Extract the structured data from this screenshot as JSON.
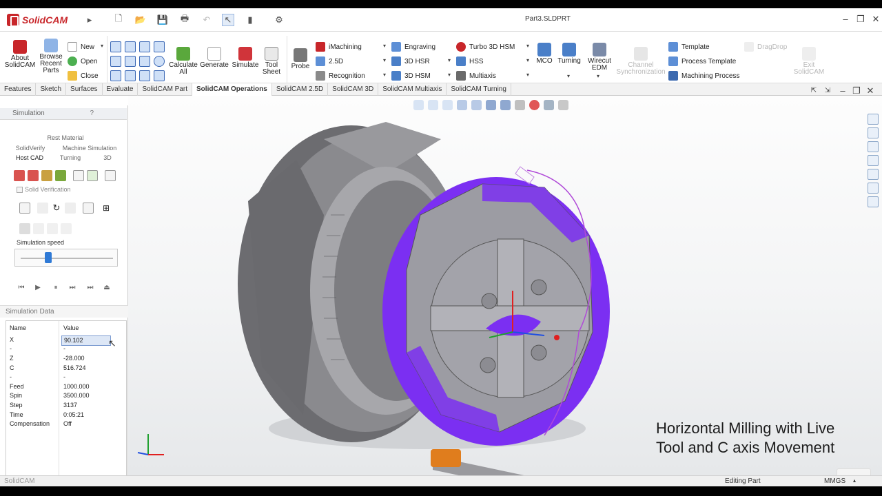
{
  "app": {
    "brand": "SolidCAM",
    "document_title": "Part3.SLDPRT",
    "window_controls": [
      "minimize-icon",
      "restore-icon",
      "close-icon"
    ]
  },
  "ribbon": {
    "about_label": "About\nSolidCAM",
    "browse_label": "Browse\nRecent\nParts",
    "new_label": "New",
    "open_label": "Open",
    "close_label": "Close",
    "calculate_label": "Calculate\nAll",
    "generate_label": "Generate",
    "simulate_label": "Simulate",
    "tool_sheet_label": "Tool\nSheet",
    "probe_label": "Probe",
    "imachining_label": "iMachining",
    "twofive_label": "2.5D",
    "recognition_label": "Recognition",
    "engraving_label": "Engraving",
    "hsr_label": "3D HSR",
    "hsm_label": "3D HSM",
    "turbo_label": "Turbo 3D HSM",
    "hss_label": "HSS",
    "multiaxis_label": "Multiaxis",
    "mco_label": "MCO",
    "turning_label": "Turning",
    "wirecut_label": "Wirecut\nEDM",
    "channel_label": "Channel\nSynchronization",
    "template_label": "Template",
    "process_template_label": "Process Template",
    "machining_process_label": "Machining Process",
    "dragdrop_label": "DragDrop",
    "exit_label": "Exit\nSolidCAM"
  },
  "tabs": [
    "Features",
    "Sketch",
    "Surfaces",
    "Evaluate",
    "SolidCAM Part",
    "SolidCAM Operations",
    "SolidCAM 2.5D",
    "SolidCAM 3D",
    "SolidCAM Multiaxis",
    "SolidCAM Turning"
  ],
  "active_tab": "SolidCAM Operations",
  "panel": {
    "title": "Simulation",
    "help": "?",
    "tab_rest": "Rest Material",
    "tab_solidverify": "SolidVerify",
    "tab_machine": "Machine Simulation",
    "tab_hostcad": "Host CAD",
    "tab_turning": "Turning",
    "tab_3d": "3D",
    "solid_verification": "Solid Verification",
    "speed_label": "Simulation speed",
    "speed_value": 0.3
  },
  "sim_data": {
    "title": "Simulation Data",
    "col_name": "Name",
    "col_value": "Value",
    "rows": [
      {
        "name": "X",
        "value": "90.102"
      },
      {
        "name": "-",
        "value": "-"
      },
      {
        "name": "Z",
        "value": "-28.000"
      },
      {
        "name": "C",
        "value": "516.724"
      },
      {
        "name": "-",
        "value": "-"
      },
      {
        "name": "Feed",
        "value": "1000.000"
      },
      {
        "name": "Spin",
        "value": "3500.000"
      },
      {
        "name": "Step",
        "value": "3137"
      },
      {
        "name": "Time",
        "value": "0:05:21"
      },
      {
        "name": "Compensation",
        "value": "Off"
      }
    ]
  },
  "status": {
    "left": "SolidCAM",
    "mode": "Editing Part",
    "units": "MMGS"
  },
  "caption": {
    "line1": "Horizontal Milling with Live",
    "line2": "Tool and C axis Movement"
  },
  "colors": {
    "brand": "#c8262a",
    "toolpath": "#7b2ff2",
    "part": "#8e8e91",
    "tool_holder": "#e07d1d",
    "slider": "#2f7ad6"
  }
}
